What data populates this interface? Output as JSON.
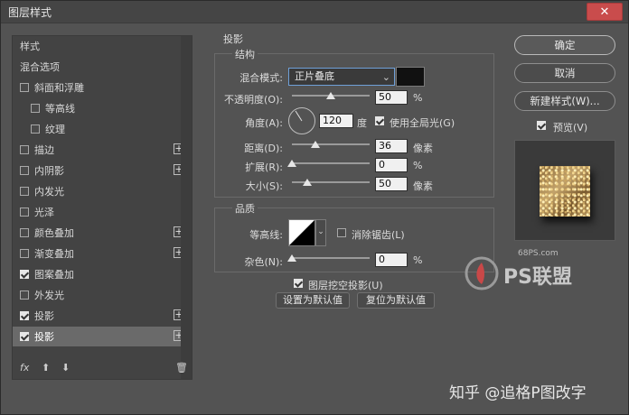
{
  "window": {
    "title": "图层样式"
  },
  "sidebar": {
    "items": [
      {
        "label": "样式",
        "checkbox": false,
        "checked": false,
        "plus": false,
        "indent": 0,
        "selected": false
      },
      {
        "label": "混合选项",
        "checkbox": false,
        "checked": false,
        "plus": false,
        "indent": 0,
        "selected": false
      },
      {
        "label": "斜面和浮雕",
        "checkbox": true,
        "checked": false,
        "plus": false,
        "indent": 0,
        "selected": false
      },
      {
        "label": "等高线",
        "checkbox": true,
        "checked": false,
        "plus": false,
        "indent": 1,
        "selected": false
      },
      {
        "label": "纹理",
        "checkbox": true,
        "checked": false,
        "plus": false,
        "indent": 1,
        "selected": false
      },
      {
        "label": "描边",
        "checkbox": true,
        "checked": false,
        "plus": true,
        "indent": 0,
        "selected": false
      },
      {
        "label": "内阴影",
        "checkbox": true,
        "checked": false,
        "plus": true,
        "indent": 0,
        "selected": false
      },
      {
        "label": "内发光",
        "checkbox": true,
        "checked": false,
        "plus": false,
        "indent": 0,
        "selected": false
      },
      {
        "label": "光泽",
        "checkbox": true,
        "checked": false,
        "plus": false,
        "indent": 0,
        "selected": false
      },
      {
        "label": "颜色叠加",
        "checkbox": true,
        "checked": false,
        "plus": true,
        "indent": 0,
        "selected": false
      },
      {
        "label": "渐变叠加",
        "checkbox": true,
        "checked": false,
        "plus": true,
        "indent": 0,
        "selected": false
      },
      {
        "label": "图案叠加",
        "checkbox": true,
        "checked": true,
        "plus": false,
        "indent": 0,
        "selected": false
      },
      {
        "label": "外发光",
        "checkbox": true,
        "checked": false,
        "plus": false,
        "indent": 0,
        "selected": false
      },
      {
        "label": "投影",
        "checkbox": true,
        "checked": true,
        "plus": true,
        "indent": 0,
        "selected": false
      },
      {
        "label": "投影",
        "checkbox": true,
        "checked": true,
        "plus": true,
        "indent": 0,
        "selected": true
      }
    ],
    "bottom": {
      "fx": "fx",
      "up": "⬆",
      "down": "⬇",
      "trash": "🗑"
    }
  },
  "shadow": {
    "section_title": "投影",
    "structure": {
      "title": "结构",
      "blend_mode_label": "混合模式:",
      "blend_mode_value": "正片叠底",
      "opacity_label": "不透明度(O):",
      "opacity_value": "50",
      "opacity_unit": "%",
      "opacity_fraction": 0.5,
      "angle_label": "角度(A):",
      "angle_value": "120",
      "angle_unit": "度",
      "global_light_label": "使用全局光(G)",
      "global_light_checked": true,
      "distance_label": "距离(D):",
      "distance_value": "36",
      "distance_unit": "像素",
      "distance_fraction": 0.3,
      "spread_label": "扩展(R):",
      "spread_value": "0",
      "spread_unit": "%",
      "spread_fraction": 0,
      "size_label": "大小(S):",
      "size_value": "50",
      "size_unit": "像素",
      "size_fraction": 0.2
    },
    "quality": {
      "title": "品质",
      "contour_label": "等高线:",
      "antialias_label": "消除锯齿(L)",
      "antialias_checked": false,
      "noise_label": "杂色(N):",
      "noise_value": "0",
      "noise_unit": "%",
      "noise_fraction": 0
    },
    "knockout_label": "图层挖空投影(U)",
    "knockout_checked": true,
    "set_default_label": "设置为默认值",
    "reset_default_label": "复位为默认值"
  },
  "actions": {
    "ok_label": "确定",
    "cancel_label": "取消",
    "new_style_label": "新建样式(W)...",
    "preview_label": "预览(V)",
    "preview_checked": true
  },
  "watermarks": {
    "site": "68PS.com",
    "brand": "PS联盟",
    "author": "知乎 @追格P图改字"
  }
}
